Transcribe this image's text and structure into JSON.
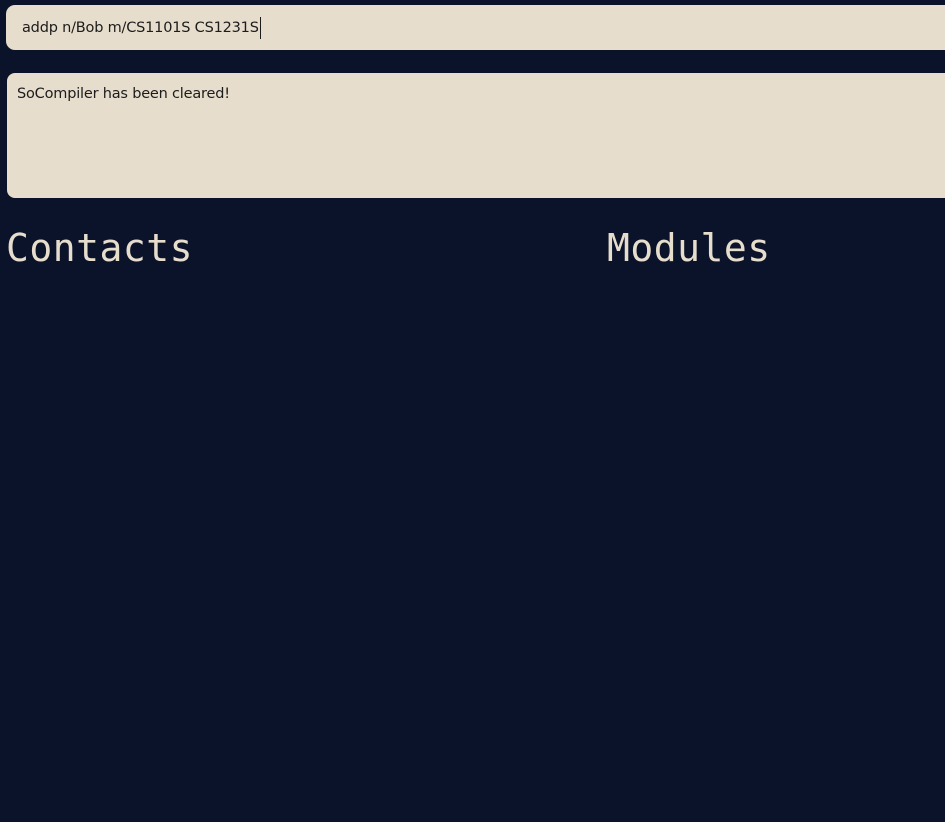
{
  "command_box": {
    "value": "addp n/Bob m/CS1101S CS1231S"
  },
  "result_display": {
    "text": "SoCompiler has been cleared!"
  },
  "sections": {
    "contacts_title": "Contacts",
    "modules_title": "Modules"
  },
  "colors": {
    "background": "#0b132b",
    "panel": "#e6ddcc",
    "heading": "#e6ddcc"
  }
}
